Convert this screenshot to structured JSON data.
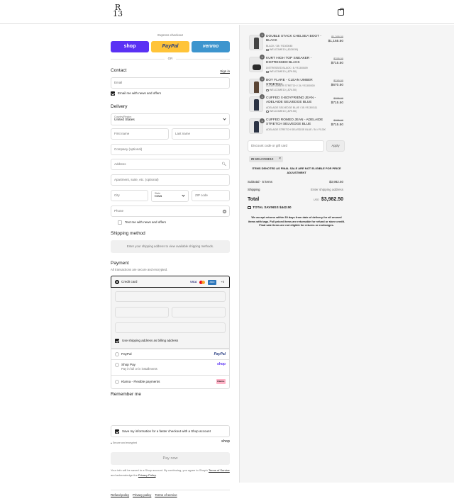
{
  "header": {
    "logo_top": "R",
    "logo_bottom": "13",
    "cart_icon": "shopping-bag-icon"
  },
  "express": {
    "title": "Express checkout",
    "shop_label": "shop",
    "paypal_label": "PayPal",
    "venmo_label": "venmo",
    "or_label": "OR"
  },
  "contact": {
    "heading": "Contact",
    "sign_in": "Sign in",
    "email_placeholder": "Email",
    "news_label": "Email me with news and offers"
  },
  "delivery": {
    "heading": "Delivery",
    "country_label": "Country/Region",
    "country_value": "United States",
    "first_name": "First name",
    "last_name": "Last name",
    "company": "Company (optional)",
    "address": "Address",
    "apartment": "Apartment, suite, etc. (optional)",
    "city": "City",
    "state_label": "State",
    "state_value": "Iowa",
    "zip": "ZIP code",
    "phone": "Phone",
    "text_label": "Text me with news and offers"
  },
  "shipping": {
    "heading": "Shipping method",
    "placeholder": "Enter your shipping address to view available shipping methods."
  },
  "payment": {
    "heading": "Payment",
    "subtitle": "All transactions are secure and encrypted.",
    "credit_card": "Credit card",
    "card_visa": "VISA",
    "card_amex": "AMEX",
    "card_more": "+5",
    "billing_label": "Use shipping address as billing address",
    "paypal": "PayPal",
    "paypal_logo": "PayPal",
    "shop_pay": "Shop Pay",
    "shop_pay_sub": "Pay in full or in installments",
    "shop_pay_logo": "shop",
    "klarna": "Klarna - Flexible payments",
    "klarna_logo": "Klarna."
  },
  "remember": {
    "heading": "Remember me",
    "save_label": "Save my information for a faster checkout with a Shop account",
    "secure": "Secure and encrypted",
    "shop_logo": "shop"
  },
  "pay_now": "Pay now",
  "fine_print": {
    "line1": "Your info will be saved to a Shop account. By continuing, you agree to Shop's",
    "terms": "Terms of Service",
    "mid": " and acknowledge the ",
    "privacy": "Privacy Policy",
    "end": "."
  },
  "footer": {
    "refund": "Refund policy",
    "privacy": "Privacy policy",
    "terms": "Terms of service"
  },
  "items": [
    {
      "qty": "1",
      "name": "DOUBLE STACK CHELSEA BOOT - BLACK",
      "variant": "BLACK / 38 / R1300045",
      "discount": "WELCOME10 (-$128.50)",
      "old": "$1,295.00",
      "new": "$1,165.50"
    },
    {
      "qty": "1",
      "name": "KURT HIGH TOP SNEAKER - DISTRESSED BLACK",
      "variant": "DISTRESSED BLACK / 8 / R1300609",
      "discount": "WELCOME10 (-$79.50)",
      "old": "$795.00",
      "new": "$715.50"
    },
    {
      "qty": "1",
      "name": "BOY FLARE - CLEAN UMBER STRETCH",
      "variant": "CLEAN UMBER STRETCH / 24 / R1300000",
      "discount": "WELCOME10 (-$74.50)",
      "old": "$745.00",
      "new": "$670.50"
    },
    {
      "qty": "1",
      "name": "CUFFED X-BOYFRIEND JEAN - ADELAIDE SELVEDGE BLUE",
      "variant": "ADELAIDE SELVEDGE BLUE / 35 / R1300111",
      "discount": "WELCOME10 (-$79.50)",
      "old": "$795.00",
      "new": "$715.50"
    },
    {
      "qty": "1",
      "name": "CUFFED ROMEO JEAN - ADELAIDE STRETCH SELVEDGE BLUE",
      "variant": "ADELAIDE STRETCH SELVEDGE BLUE / 34 / R1300113",
      "discount": "",
      "old": "$795.00",
      "new": "$715.50"
    }
  ],
  "discount": {
    "placeholder": "Discount code or gift card",
    "apply": "Apply",
    "chip": "WELCOME10"
  },
  "final_sale_note": "ITEMS DENOTED AS FINAL SALE ARE NOT ELIGIBLE FOR PRICE ADJUSTMENT",
  "summary": {
    "subtotal_label": "Subtotal · 5 items",
    "subtotal_value": "$3,982.50",
    "shipping_label": "Shipping",
    "shipping_value": "Enter shipping address",
    "total_label": "Total",
    "currency": "USD",
    "total_value": "$3,982.50",
    "savings_label": "TOTAL SAVINGS",
    "savings_value": "$442.50"
  },
  "returns_note": "We accept returns within 30 days from date of delivery for all unused items with tags. Full priced items are returnable for refund or store credit. Final sale items are not eligible for returns or exchanges."
}
